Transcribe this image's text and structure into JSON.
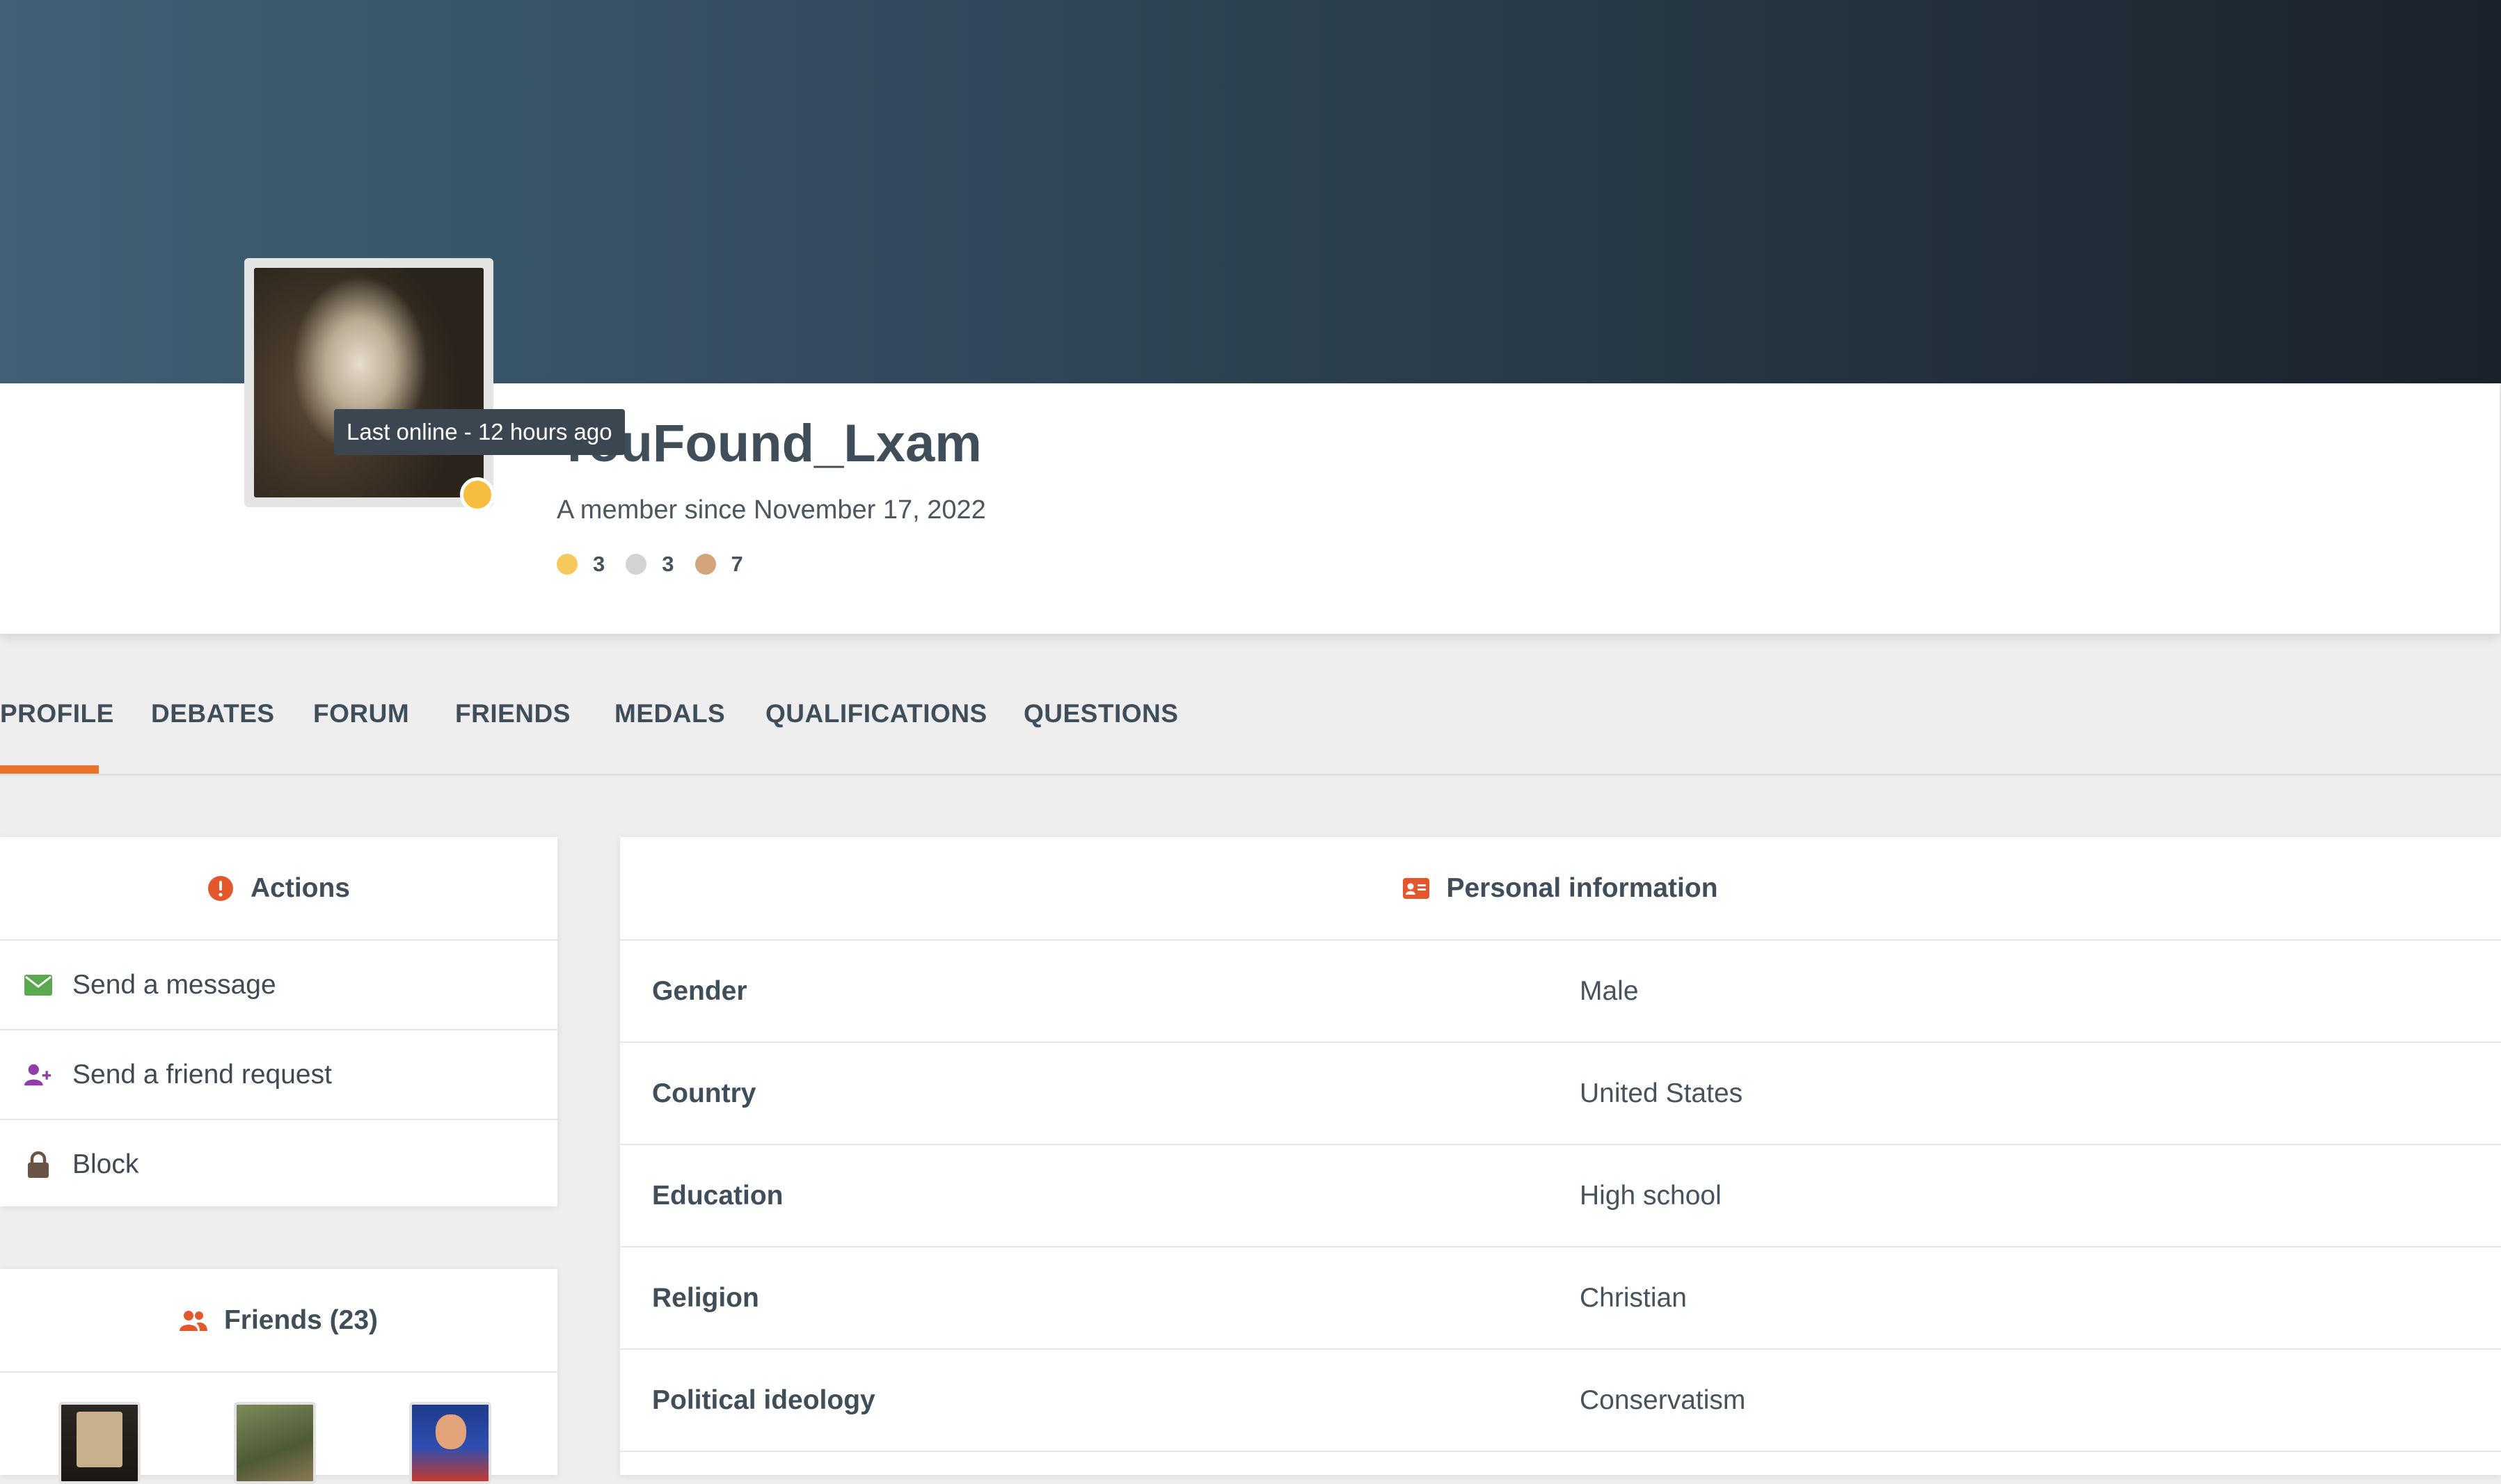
{
  "profile": {
    "username": "YouFound_Lxam",
    "member_since": "A member since November 17, 2022",
    "tooltip": "Last online - 12 hours ago",
    "status_color": "#f6bd3e",
    "medals": [
      {
        "name": "gold",
        "color": "#f7c85c",
        "count": "3"
      },
      {
        "name": "silver",
        "color": "#d3d3d3",
        "count": "3"
      },
      {
        "name": "bronze",
        "color": "#d4a57c",
        "count": "7"
      }
    ]
  },
  "tabs": [
    "PROFILE",
    "DEBATES",
    "FORUM",
    "FRIENDS",
    "MEDALS",
    "QUALIFICATIONS",
    "QUESTIONS"
  ],
  "active_tab": "PROFILE",
  "actions": {
    "title": "Actions",
    "title_icon": "alert-circle-icon",
    "items": [
      {
        "label": "Send a message",
        "icon": "envelope-icon",
        "color": "#5aa84f"
      },
      {
        "label": "Send a friend request",
        "icon": "user-plus-icon",
        "color": "#8e3fa8"
      },
      {
        "label": "Block",
        "icon": "lock-icon",
        "color": "#6a5445"
      }
    ]
  },
  "friends": {
    "title": "Friends (23)",
    "icon": "users-icon"
  },
  "personal_info": {
    "title": "Personal information",
    "icon": "id-card-icon",
    "rows": [
      {
        "label": "Gender",
        "value": "Male"
      },
      {
        "label": "Country",
        "value": "United States"
      },
      {
        "label": "Education",
        "value": "High school"
      },
      {
        "label": "Religion",
        "value": "Christian"
      },
      {
        "label": "Political ideology",
        "value": "Conservatism"
      }
    ]
  },
  "colors": {
    "accent": "#e8732a",
    "icon_red": "#e2572c"
  }
}
